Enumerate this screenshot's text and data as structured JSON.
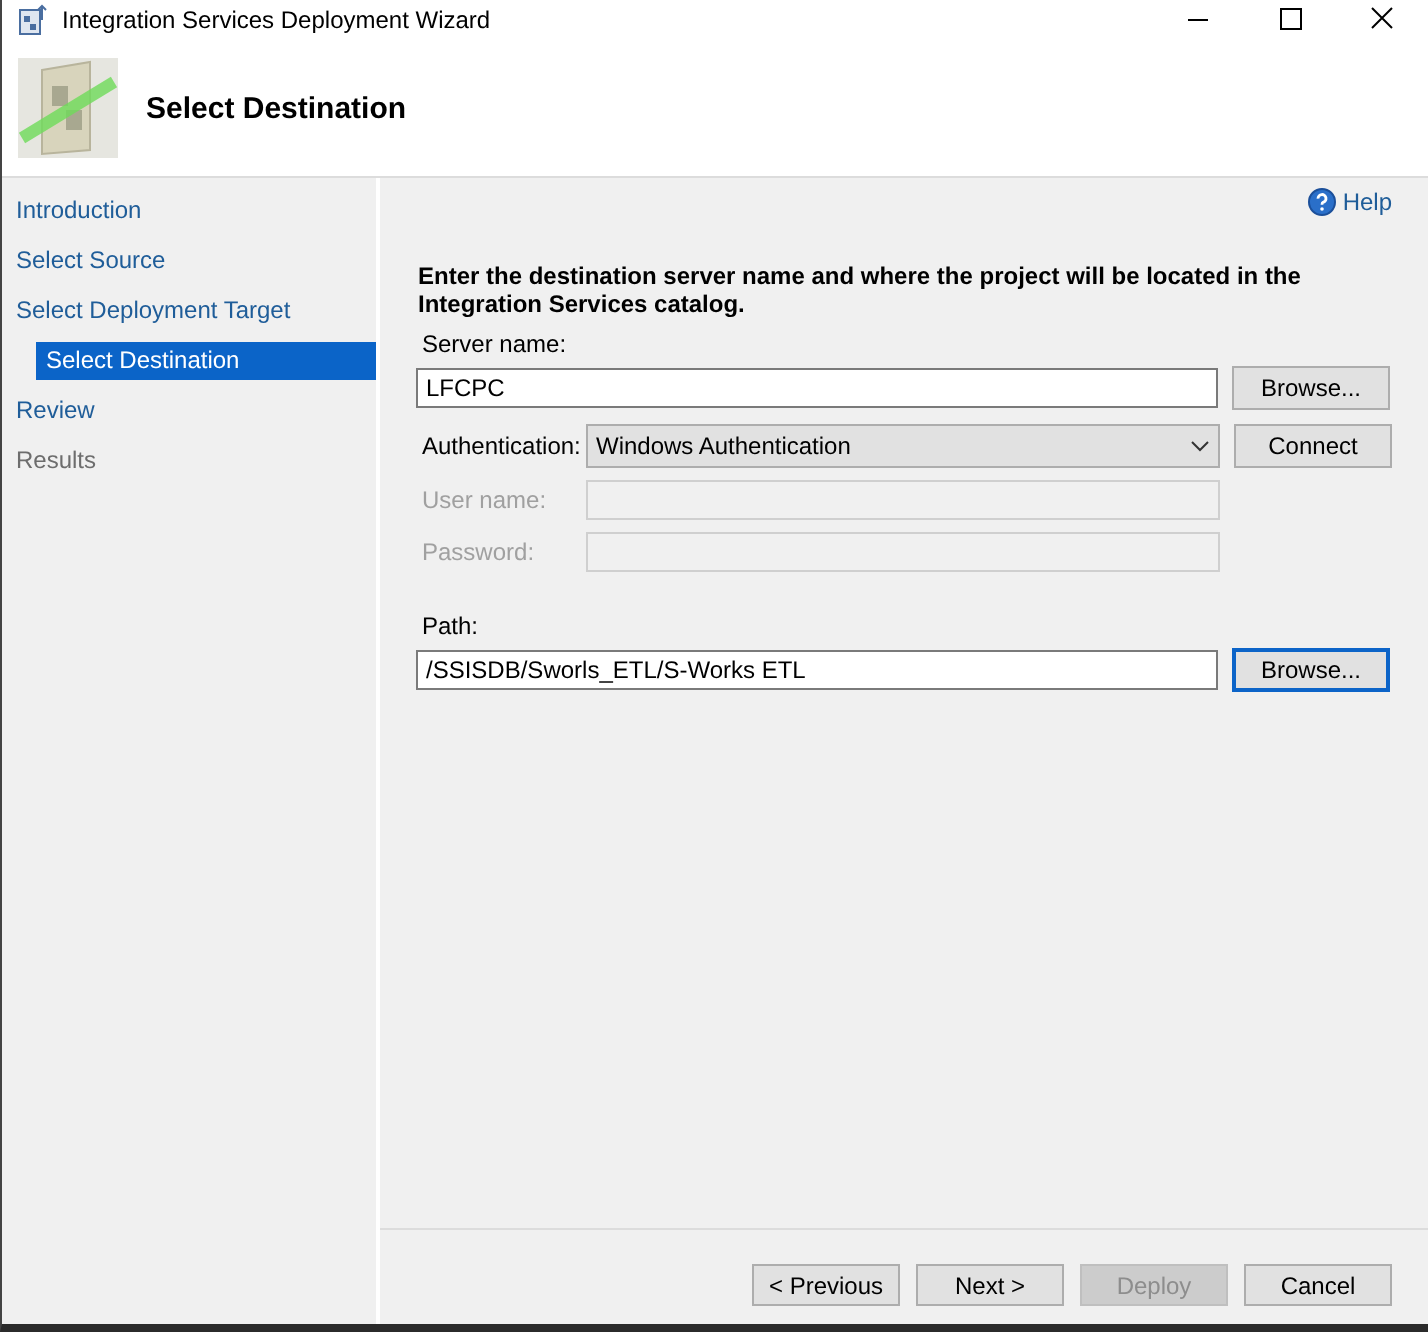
{
  "window": {
    "title": "Integration Services Deployment Wizard"
  },
  "header": {
    "title": "Select Destination"
  },
  "nav": {
    "items": [
      {
        "label": "Introduction",
        "selected": false,
        "disabled": false
      },
      {
        "label": "Select Source",
        "selected": false,
        "disabled": false
      },
      {
        "label": "Select Deployment Target",
        "selected": false,
        "disabled": false,
        "children": [
          {
            "label": "Select Destination",
            "selected": true,
            "disabled": false
          }
        ]
      },
      {
        "label": "Review",
        "selected": false,
        "disabled": false
      },
      {
        "label": "Results",
        "selected": false,
        "disabled": true
      }
    ]
  },
  "help": {
    "label": "Help"
  },
  "instructions": "Enter the destination server name and where the project will be located in the Integration Services catalog.",
  "fields": [
    {
      "kind": "stacked",
      "label": "Server name:",
      "value": "LFCPC",
      "disabled": false,
      "button": {
        "label": "Browse...",
        "focused": false
      }
    },
    {
      "kind": "dropdown",
      "label": "Authentication:",
      "value": "Windows Authentication",
      "disabled": false,
      "button": {
        "label": "Connect",
        "focused": false
      }
    },
    {
      "kind": "inline",
      "label": "User name:",
      "disabled": true
    },
    {
      "kind": "inline",
      "label": "Password:",
      "disabled": true
    },
    {
      "kind": "stacked",
      "label": "Path:",
      "value": "/SSISDB/Sworls_ETL/S-Works ETL",
      "disabled": false,
      "button": {
        "label": "Browse...",
        "focused": true
      }
    }
  ],
  "footer": {
    "buttons": [
      {
        "label": "< Previous",
        "disabled": false
      },
      {
        "label": "Next >",
        "disabled": false
      },
      {
        "label": "Deploy",
        "disabled": true
      },
      {
        "label": "Cancel",
        "disabled": false
      }
    ]
  }
}
